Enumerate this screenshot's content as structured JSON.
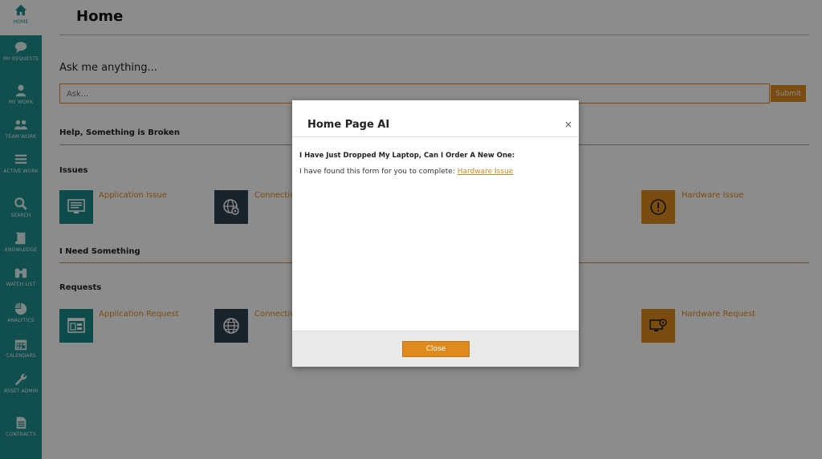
{
  "sidebar": {
    "items": [
      {
        "label": "HOME",
        "icon": "home-icon"
      },
      {
        "label": "MY REQUESTS",
        "icon": "chat-icon"
      },
      {
        "label": "MY WORK",
        "icon": "user-icon"
      },
      {
        "label": "TEAM WORK",
        "icon": "team-icon"
      },
      {
        "label": "ACTIVE WORK",
        "icon": "list-icon"
      },
      {
        "label": "SEARCH",
        "icon": "search-icon"
      },
      {
        "label": "KNOWLEDGE",
        "icon": "book-icon"
      },
      {
        "label": "WATCH LIST",
        "icon": "binoculars-icon"
      },
      {
        "label": "ANALYTICS",
        "icon": "pie-chart-icon"
      },
      {
        "label": "CALENDARS",
        "icon": "calendar-icon"
      },
      {
        "label": "ASSET ADMIN",
        "icon": "wrench-icon"
      },
      {
        "label": "CONTRACTS",
        "icon": "document-icon"
      }
    ]
  },
  "header": {
    "title": "Home"
  },
  "ask": {
    "label": "Ask me anything...",
    "placeholder": "Ask...",
    "submit_label": "Submit"
  },
  "sections": {
    "broken": {
      "title": "Help, Something is Broken",
      "subtitle": "Issues",
      "tiles": [
        {
          "label": "Application Issue",
          "icon": "monitor-icon"
        },
        {
          "label": "Connectiv",
          "icon": "globe-gear-icon"
        },
        {
          "label": "Hardware Issue",
          "icon": "alert-icon"
        }
      ]
    },
    "need": {
      "title": "I Need Something",
      "subtitle": "Requests",
      "tiles": [
        {
          "label": "Application Request",
          "icon": "app-window-icon"
        },
        {
          "label": "Connectiv",
          "icon": "globe-icon"
        },
        {
          "label": "Hardware Request",
          "icon": "hardware-request-icon"
        }
      ]
    }
  },
  "modal": {
    "title": "Home Page AI",
    "close_symbol": "×",
    "question": "I Have Just Dropped My Laptop, Can I Order A New One:",
    "answer_prefix": "I have found this form for you to complete: ",
    "answer_link": "Hardware Issue",
    "close_label": "Close"
  },
  "colors": {
    "accent": "#e08a1e",
    "sidebar": "#1f8f8f",
    "tile_teal": "#1a8a8a",
    "tile_navy": "#2e4150"
  }
}
